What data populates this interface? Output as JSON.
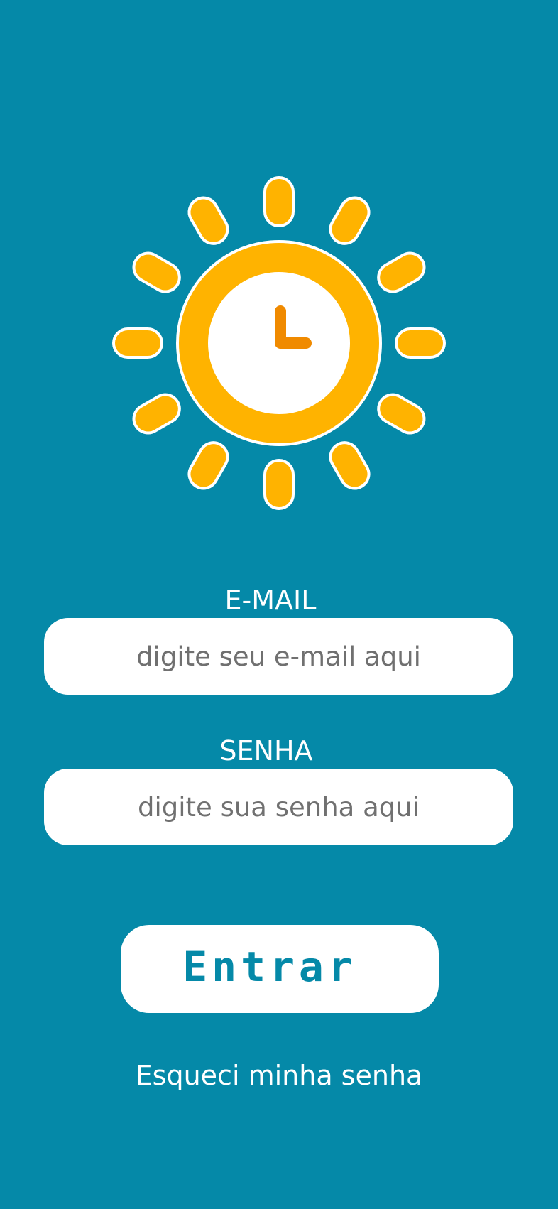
{
  "colors": {
    "background": "#0589A8",
    "sun_yellow": "#FFB300",
    "clock_hands": "#F08A00",
    "white": "#FFFFFF"
  },
  "logo": {
    "icon": "sun-clock-icon"
  },
  "email": {
    "label": "E-MAIL",
    "placeholder": "digite seu e-mail aqui",
    "value": ""
  },
  "password": {
    "label": "SENHA",
    "placeholder": "digite sua senha aqui",
    "value": ""
  },
  "actions": {
    "enter_label": "Entrar",
    "forgot_label": "Esqueci minha senha"
  }
}
